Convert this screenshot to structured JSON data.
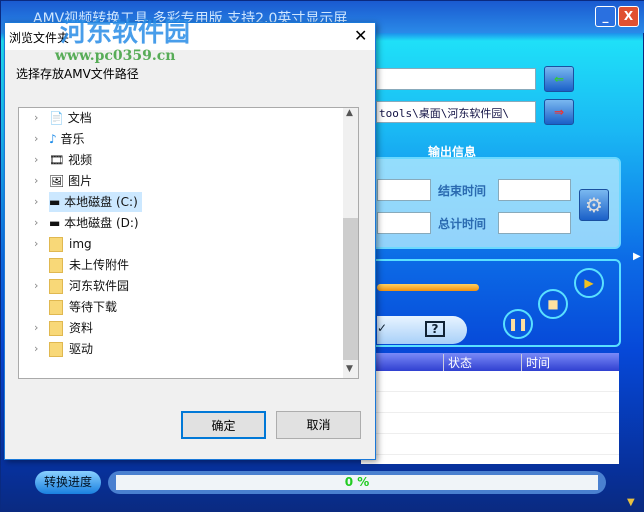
{
  "window": {
    "title": "AMV视频转换工具 多彩专用版 支持2.0英寸显示屏",
    "minimize": "_",
    "close": "X"
  },
  "watermark": {
    "name": "河东软件园",
    "url": "www.pc0359.cn"
  },
  "main": {
    "input_path": "",
    "output_path": "tools\\桌面\\河东软件园\\",
    "output_group": "输出信息",
    "end_time_label": "结束时间",
    "total_time_label": "总计时间",
    "help": "?",
    "check": "✓",
    "table_headers": [
      "状态",
      "时间"
    ],
    "progress_label": "转换进度",
    "progress_text": "0 %",
    "progress": 0
  },
  "dialog": {
    "title": "浏览文件夹",
    "prompt": "选择存放AMV文件路径",
    "ok": "确定",
    "cancel": "取消",
    "items": [
      {
        "label": "文档",
        "icon": "document-icon"
      },
      {
        "label": "音乐",
        "icon": "music-icon"
      },
      {
        "label": "视频",
        "icon": "video-icon"
      },
      {
        "label": "图片",
        "icon": "picture-icon"
      },
      {
        "label": "本地磁盘 (C:)",
        "icon": "drive-icon",
        "selected": true
      },
      {
        "label": "本地磁盘 (D:)",
        "icon": "drive-icon"
      },
      {
        "label": "img"
      },
      {
        "label": "未上传附件"
      },
      {
        "label": "河东软件园"
      },
      {
        "label": "等待下载"
      },
      {
        "label": "资料"
      },
      {
        "label": "驱动"
      }
    ]
  }
}
